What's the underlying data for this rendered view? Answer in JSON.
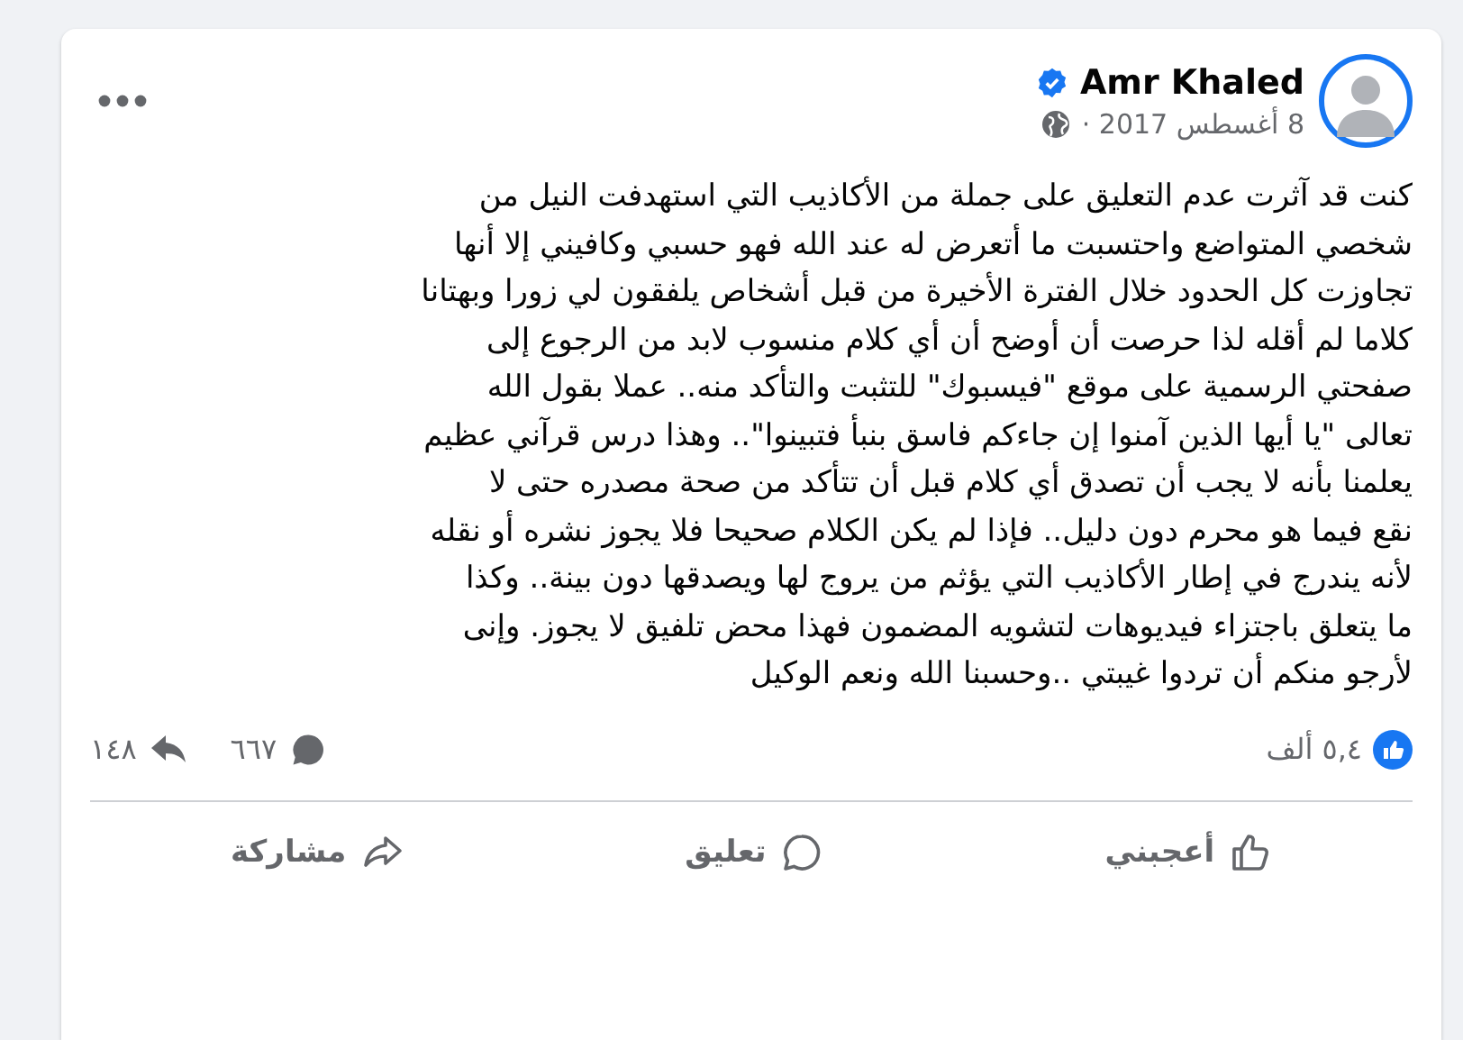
{
  "post": {
    "author": "Amr Khaled",
    "verified": true,
    "date": "8 أغسطس 2017 ·",
    "body": "كنت قد آثرت عدم التعليق على جملة من الأكاذيب التي استهدفت النيل من\nشخصي المتواضع واحتسبت ما أتعرض له عند الله فهو حسبي وكافيني إلا أنها\nتجاوزت كل الحدود خلال الفترة الأخيرة من قبل أشخاص يلفقون لي  زورا وبهتانا\nكلاما لم أقله لذا حرصت أن أوضح أن أي كلام منسوب لابد من الرجوع إلى\nصفحتي الرسمية على موقع \"فيسبوك\" للتثبت والتأكد منه.. عملا بقول الله\nتعالى \"يا أيها الذين آمنوا إن جاءكم فاسق بنبأ فتبينوا\".. وهذا درس قرآني عظيم\nيعلمنا بأنه لا يجب أن تصدق أي كلام  قبل أن تتأكد من صحة مصدره حتى لا\nنقع فيما هو محرم دون دليل.. فإذا لم يكن الكلام صحيحا فلا يجوز نشره أو نقله\nلأنه يندرج في إطار الأكاذيب التي يؤثم من يروج لها ويصدقها دون بينة.. وكذا\nما يتعلق باجتزاء فيديوهات لتشويه المضمون فهذا محض تلفيق لا يجوز. وإنى\nلأرجو منكم أن تردوا غيبتي ..وحسبنا الله ونعم الوكيل"
  },
  "stats": {
    "likes": "٥,٤ ألف",
    "comments": "٦٦٧",
    "shares": "١٤٨"
  },
  "actions": [
    {
      "kind": "like",
      "label": "أعجبني"
    },
    {
      "kind": "comment",
      "label": "تعليق"
    },
    {
      "kind": "share",
      "label": "مشاركة"
    }
  ]
}
